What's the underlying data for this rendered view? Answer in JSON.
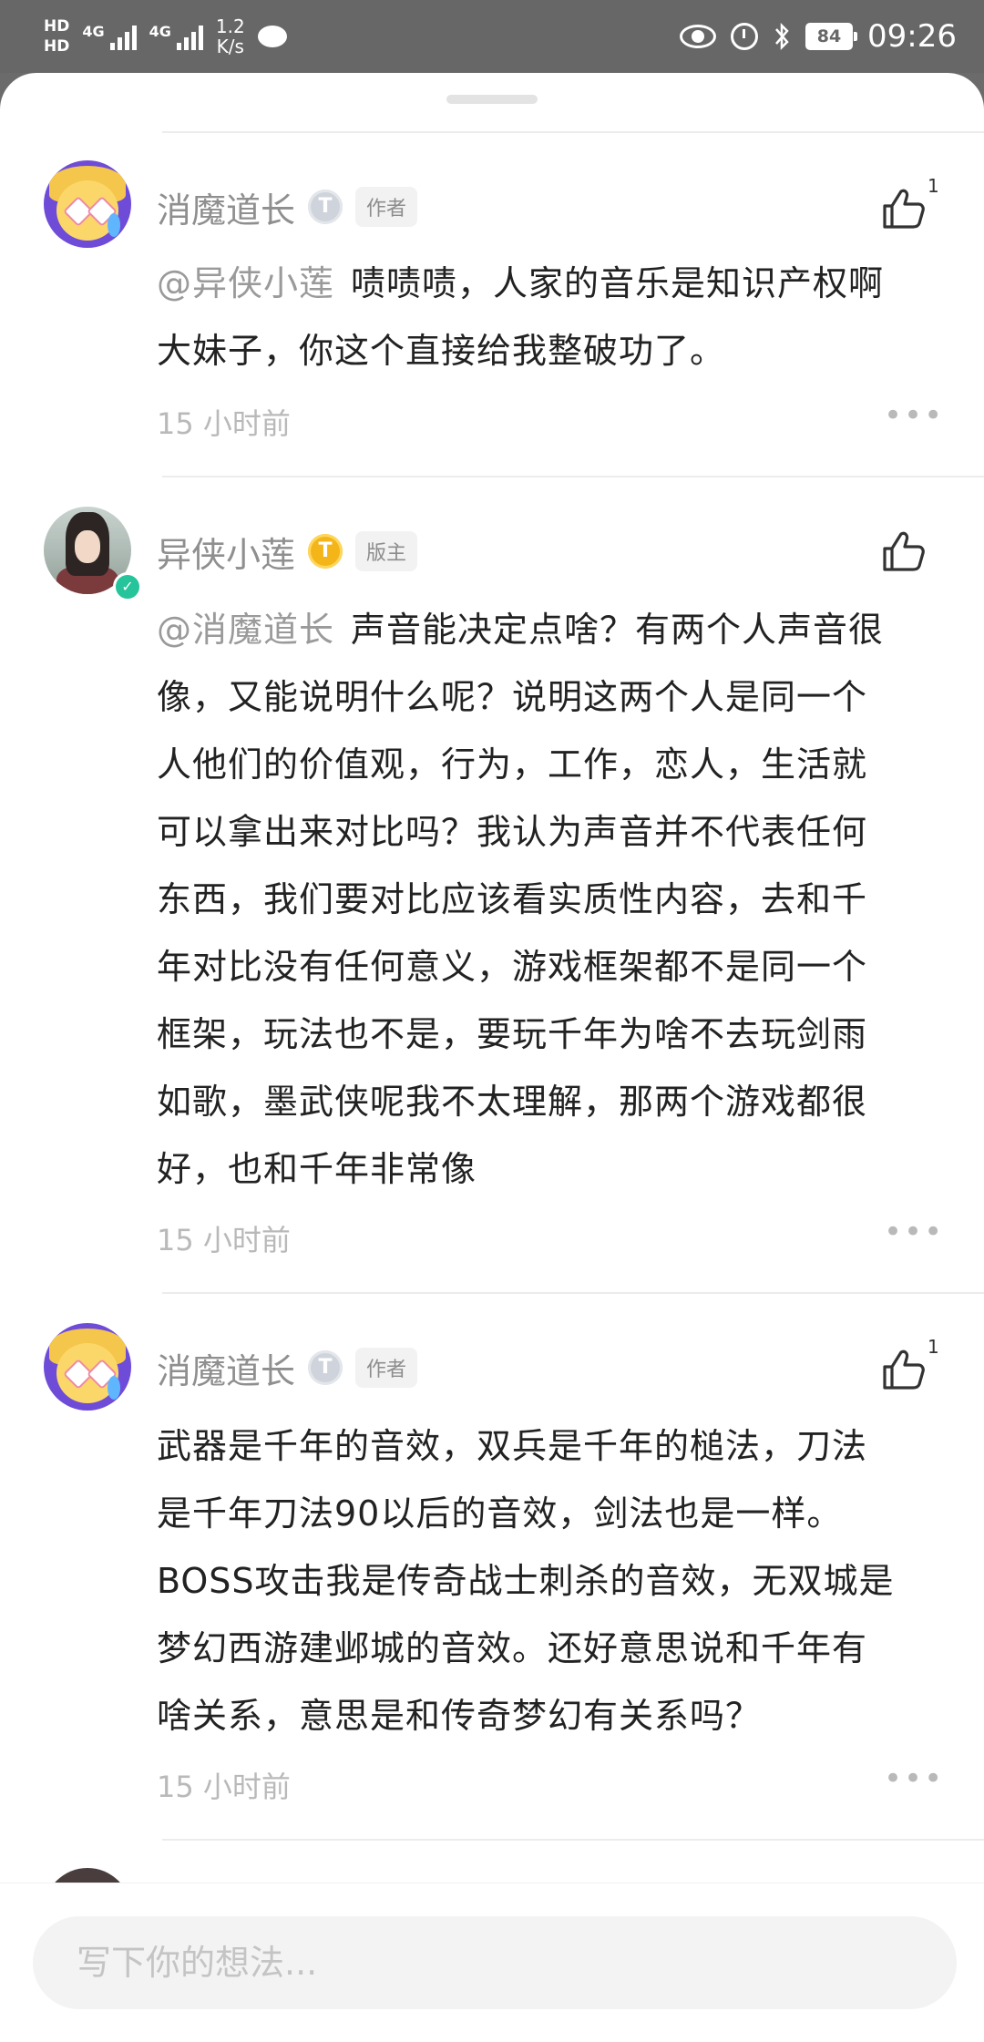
{
  "status_bar": {
    "hd1": "HD",
    "hd2": "HD",
    "net1": "4G",
    "net2": "4G",
    "speed_value": "1.2",
    "speed_unit": "K/s",
    "battery": "84",
    "time": "09:26"
  },
  "comments": [
    {
      "username": "消魔道长",
      "level_badge": "T",
      "role": "作者",
      "like_count": "1",
      "mention": "@异侠小莲",
      "text_lines": [
        "啧啧啧，人家的音乐是知识产权啊",
        "大妹子，你这个直接给我整破功了。"
      ],
      "time": "15 小时前"
    },
    {
      "username": "异侠小莲",
      "level_badge": "T",
      "role": "版主",
      "like_count": "",
      "mention": "@消魔道长",
      "text_lines": [
        "声音能决定点啥？有两个人声音很",
        "像，又能说明什么呢？说明这两个人是同一个",
        "人他们的价值观，行为，工作，恋人，生活就",
        "可以拿出来对比吗？我认为声音并不代表任何",
        "东西，我们要对比应该看实质性内容，去和千",
        "年对比没有任何意义，游戏框架都不是同一个",
        "框架，玩法也不是，要玩千年为啥不去玩剑雨",
        "如歌，墨武侠呢我不太理解，那两个游戏都很",
        "好，也和千年非常像"
      ],
      "time": "15 小时前"
    },
    {
      "username": "消魔道长",
      "level_badge": "T",
      "role": "作者",
      "like_count": "1",
      "mention": "",
      "text_lines": [
        "武器是千年的音效，双兵是千年的槌法，刀法",
        "是千年刀法90以后的音效，剑法也是一样。",
        "BOSS攻击我是传奇战士刺杀的音效，无双城是",
        "梦幻西游建邺城的音效。还好意思说和千年有",
        "啥关系，意思是和传奇梦幻有关系吗？"
      ],
      "time": "15 小时前"
    }
  ],
  "more_label": "•••",
  "input": {
    "placeholder": "写下你的想法..."
  }
}
